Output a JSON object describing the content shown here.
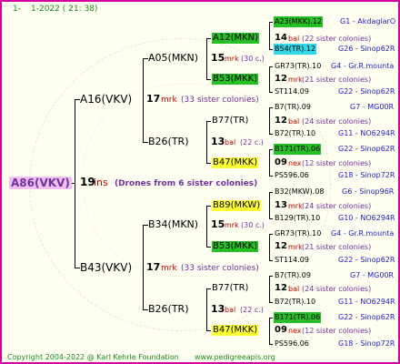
{
  "header": {
    "num": "1-",
    "date": "1-2022 ( 21: 38)"
  },
  "root": {
    "label": "A86(VKV)",
    "gen_num": "19",
    "gen_suffix": "ins",
    "note": "(Drones from 6 sister colonies)"
  },
  "gen1": [
    {
      "label": "A16(VKV)",
      "num": "17",
      "suffix": "mrk",
      "note": "(33 sister colonies)"
    },
    {
      "label": "B43(VKV)",
      "num": "17",
      "suffix": "mrk",
      "note": "(33 sister colonies)"
    }
  ],
  "gen2": [
    {
      "label": "A05(MKN)",
      "num": "15",
      "suffix": "mrk",
      "note": "(30 c.)"
    },
    {
      "label": "B26(TR)",
      "num": "13",
      "suffix": "bal",
      "note": "(22 c.)"
    },
    {
      "label": "B34(MKN)",
      "num": "15",
      "suffix": "mrk",
      "note": "(30 c.)"
    },
    {
      "label": "B26(TR)",
      "num": "13",
      "suffix": "bal",
      "note": "(22 c.)"
    }
  ],
  "gen3": [
    {
      "label": "A12(MKN)",
      "num": "14",
      "suffix": "bal",
      "note": "(22 sister colonies)"
    },
    {
      "label": "B53(MKK)",
      "num": "12",
      "suffix": "mrk",
      "note": "(21 sister colonies)"
    },
    {
      "label": "B77(TR)",
      "num": "12",
      "suffix": "bal",
      "note": "(24 sister colonies)"
    },
    {
      "label": "B47(MKK)",
      "num": "09",
      "suffix": "nex",
      "note": "(12 sister colonies)"
    },
    {
      "label": "B89(MKW)",
      "num": "13",
      "suffix": "mrk",
      "note": "(24 sister colonies)"
    },
    {
      "label": "B53(MKK)",
      "num": "12",
      "suffix": "mrk",
      "note": "(21 sister colonies)"
    },
    {
      "label": "B77(TR)",
      "num": "12",
      "suffix": "bal",
      "note": "(24 sister colonies)"
    },
    {
      "label": "B47(MKK)",
      "num": "09",
      "suffix": "nex",
      "note": "(12 sister colonies)"
    }
  ],
  "gen4": [
    {
      "label": "A23(MKK).12",
      "ref": "G1 - AkdaglarO"
    },
    {
      "label": "B54(TR).12",
      "ref": "G26 - Sinop62R"
    },
    {
      "label": "GR73(TR).10",
      "ref": "G4 - Gr.R.mounta"
    },
    {
      "label": "ST114.09",
      "ref": "G22 - Sinop62R"
    },
    {
      "label": "B7(TR).09",
      "ref": "G7 - MG00R"
    },
    {
      "label": "B72(TR).10",
      "ref": "G11 - NO6294R"
    },
    {
      "label": "B171(TR).06",
      "ref": "G22 - Sinop62R"
    },
    {
      "label": "PS596.06",
      "ref": "G18 - Sinop72R"
    },
    {
      "label": "B32(MKW).08",
      "ref": "G6 - Sinop96R"
    },
    {
      "label": "B129(TR).10",
      "ref": "G10 - NO6294R"
    },
    {
      "label": "GR73(TR).10",
      "ref": "G4 - Gr.R.mounta"
    },
    {
      "label": "ST114.09",
      "ref": "G22 - Sinop62R"
    },
    {
      "label": "B7(TR).09",
      "ref": "G7 - MG00R"
    },
    {
      "label": "B72(TR).10",
      "ref": "G11 - NO6294R"
    },
    {
      "label": "B171(TR).06",
      "ref": "G22 - Sinop62R"
    },
    {
      "label": "PS596.06",
      "ref": "G18 - Sinop72R"
    }
  ],
  "footer": {
    "copyright": "Copyright 2004-2022 @ Karl Kehrle Foundation",
    "url": "www.pedigreeapis.org"
  },
  "colors": {
    "border": "#d400a0",
    "green_box": "#26c026",
    "yellow_box": "#ffff33",
    "cyan_box": "#33d6e6",
    "root_box": "#f0c0f0"
  }
}
